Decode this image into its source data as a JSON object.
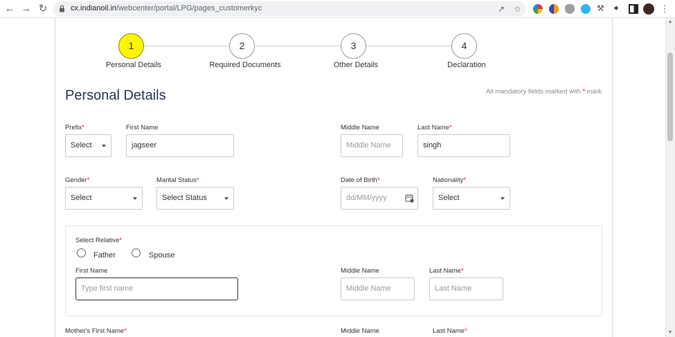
{
  "browser": {
    "url_host": "cx.indianoil.in",
    "url_path": "/webcenter/portal/LPG/pages_customerkyc",
    "back_icon": "arrow-left-icon",
    "forward_icon": "arrow-right-icon",
    "reload_icon": "reload-icon",
    "extensions": [
      "share-icon",
      "bookmark-star-icon",
      "color-ext-icon",
      "ext-icon",
      "ext-icon",
      "ext-icon",
      "ext-icon",
      "tools-ext-icon",
      "puzzle-icon",
      "sidebar-icon",
      "avatar-icon",
      "menu-icon"
    ]
  },
  "steps": [
    {
      "number": "1",
      "label": "Personal Details",
      "active": true
    },
    {
      "number": "2",
      "label": "Required Documents",
      "active": false
    },
    {
      "number": "3",
      "label": "Other Details",
      "active": false
    },
    {
      "number": "4",
      "label": "Declaration",
      "active": false
    }
  ],
  "page": {
    "title": "Personal Details",
    "mandatory_note": "All mandatory fields marked with",
    "mandatory_star": "*",
    "mandatory_suffix": "mark"
  },
  "row1": {
    "prefix": {
      "label": "Prefix",
      "value": "Select"
    },
    "first_name": {
      "label": "First Name",
      "value": "jagseer"
    },
    "middle_name": {
      "label": "Middle Name",
      "placeholder": "Middle Name"
    },
    "last_name": {
      "label": "Last Name",
      "value": "singh"
    }
  },
  "row2": {
    "gender": {
      "label": "Gender",
      "value": "Select"
    },
    "marital_status": {
      "label": "Marital Status",
      "value": "Select Status"
    },
    "dob": {
      "label": "Date of Birth",
      "placeholder": "dd/MM/yyyy"
    },
    "nationality": {
      "label": "Nationality",
      "value": "Select"
    }
  },
  "relative": {
    "label": "Select Relative",
    "options": [
      "Father",
      "Spouse"
    ],
    "first_name": {
      "label": "First Name",
      "placeholder": "Type first name"
    },
    "middle_name": {
      "label": "Middle Name",
      "placeholder": "Middle Name"
    },
    "last_name": {
      "label": "Last Name",
      "placeholder": "Last Name"
    }
  },
  "mother": {
    "first_name_label": "Mother's First Name",
    "middle_name_label": "Middle Name",
    "last_name_label": "Last Name"
  },
  "required_star": "*"
}
